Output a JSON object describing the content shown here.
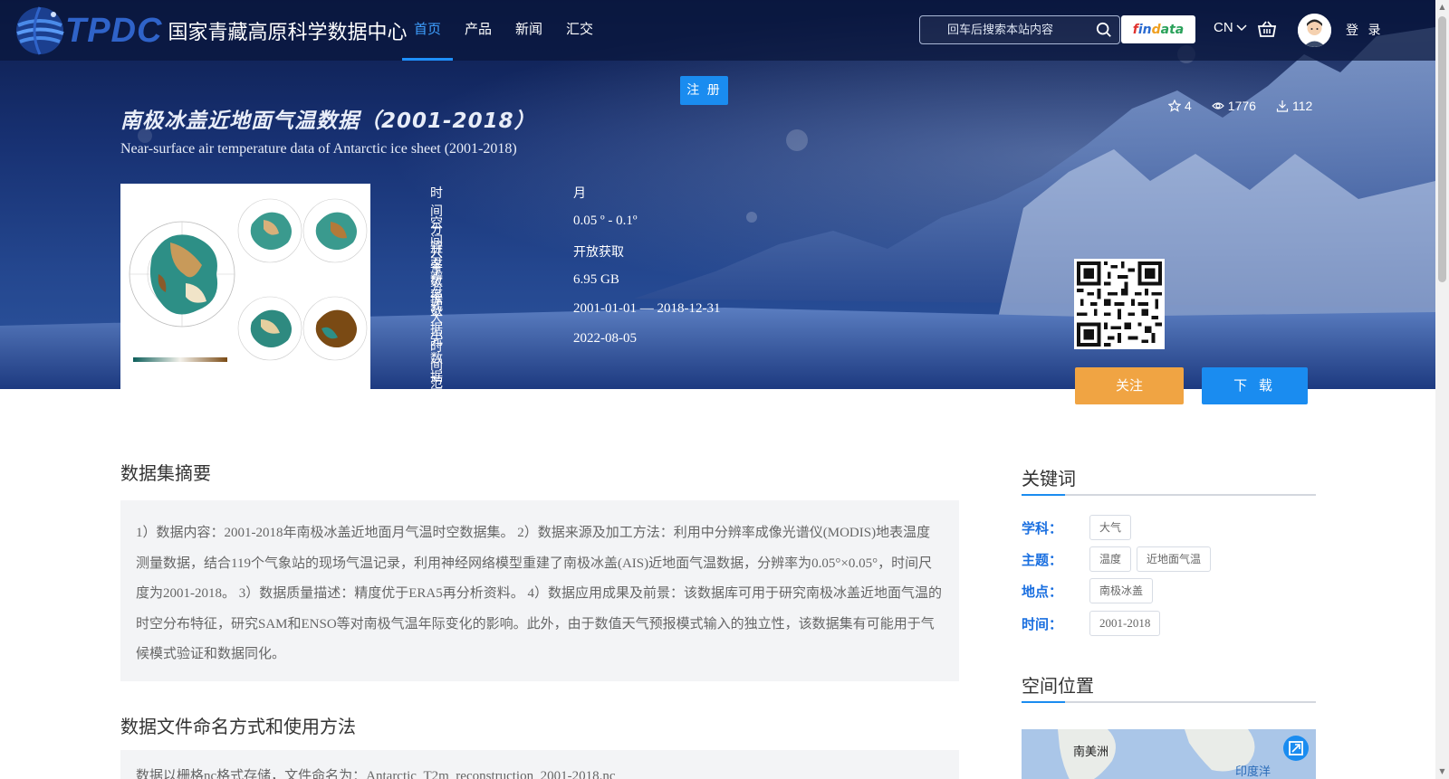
{
  "header": {
    "logo_text": "TPDC",
    "site_name": "国家青藏高原科学数据中心",
    "nav": [
      {
        "label": "首页",
        "active": true
      },
      {
        "label": "产品",
        "active": false
      },
      {
        "label": "新闻",
        "active": false
      },
      {
        "label": "汇交",
        "active": false
      }
    ],
    "search_placeholder": "回车后搜索本站内容",
    "findata": "findata",
    "lang": "CN",
    "login": "登 录",
    "register": "注 册"
  },
  "dataset": {
    "title_cn": "南极冰盖近地面气温数据（2001-2018）",
    "title_en": "Near-surface air temperature data of Antarctic ice sheet (2001-2018)",
    "stats": {
      "stars": "4",
      "views": "1776",
      "downloads": "112"
    },
    "meta": [
      {
        "key": "时间分辨率",
        "value": "月"
      },
      {
        "key": "空间分辨率",
        "value": "0.05 º - 0.1º"
      },
      {
        "key": "共享方式",
        "value": "开放获取"
      },
      {
        "key": "数据大小",
        "value": "6.95 GB"
      },
      {
        "key": "数据时间范围",
        "value": "2001-01-01 — 2018-12-31"
      },
      {
        "key": "元数据更新时间",
        "value": "2022-08-05"
      }
    ],
    "follow_label": "关注",
    "download_label": "下 载"
  },
  "abstract": {
    "title": "数据集摘要",
    "text": "1）数据内容：2001-2018年南极冰盖近地面月气温时空数据集。 2）数据来源及加工方法：利用中分辨率成像光谱仪(MODIS)地表温度测量数据，结合119个气象站的现场气温记录，利用神经网络模型重建了南极冰盖(AIS)近地面气温数据，分辨率为0.05°×0.05°，时间尺度为2001-2018。 3）数据质量描述：精度优于ERA5再分析资料。 4）数据应用成果及前景：该数据库可用于研究南极冰盖近地面气温的时空分布特征，研究SAM和ENSO等对南极气温年际变化的影响。此外，由于数值天气预报模式输入的独立性，该数据集有可能用于气候模式验证和数据同化。"
  },
  "usage": {
    "title": "数据文件命名方式和使用方法",
    "text": "数据以栅格nc格式存储，文件命名为：Antarctic_T2m_reconstruction_2001-2018.nc"
  },
  "keywords": {
    "title": "关键词",
    "rows": [
      {
        "label": "学科：",
        "tags": [
          "大气"
        ]
      },
      {
        "label": "主题：",
        "tags": [
          "温度",
          "近地面气温"
        ]
      },
      {
        "label": "地点：",
        "tags": [
          "南极冰盖"
        ]
      },
      {
        "label": "时间：",
        "tags": [
          "2001-2018"
        ]
      }
    ]
  },
  "location": {
    "title": "空间位置",
    "map_labels": [
      "南美洲",
      "印度洋"
    ]
  }
}
